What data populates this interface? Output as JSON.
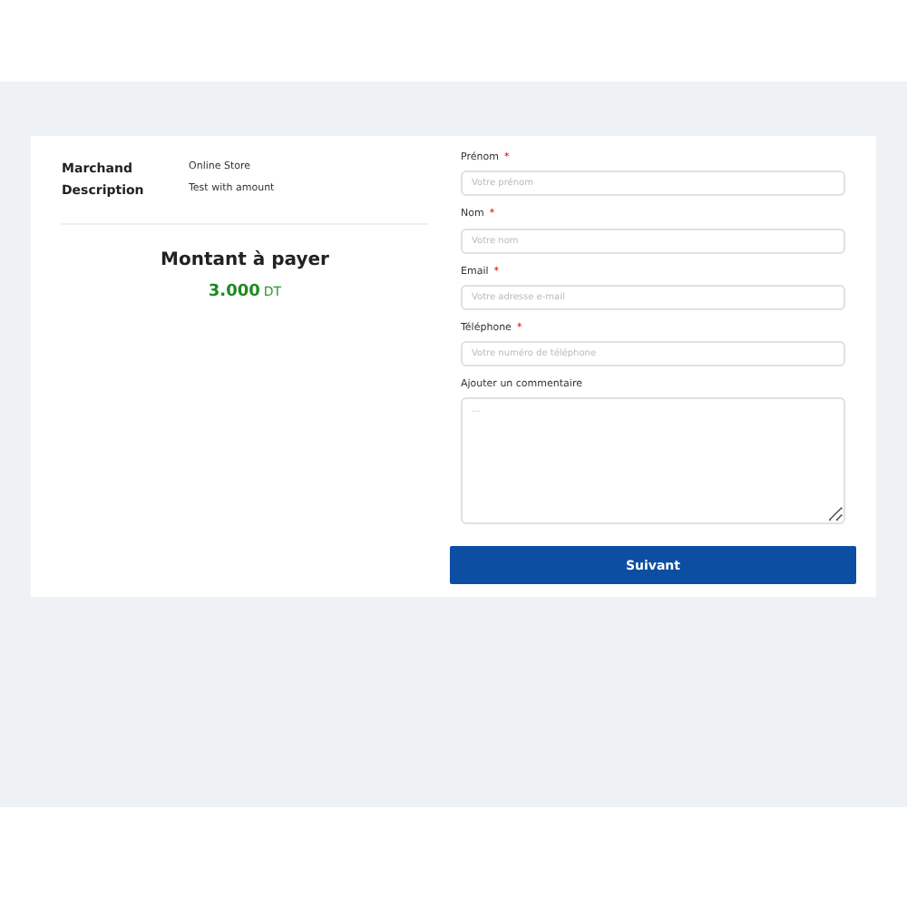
{
  "summary": {
    "rows": [
      {
        "label": "Marchand",
        "value": "Online Store"
      },
      {
        "label": "Description",
        "value": "Test with amount"
      }
    ],
    "amount_title": "Montant à payer",
    "amount": "3.000",
    "currency": "DT"
  },
  "form": {
    "fields": [
      {
        "kind": "input",
        "label": "Prénom",
        "required": true,
        "placeholder": "Votre prénom"
      },
      {
        "kind": "input",
        "label": "Nom",
        "required": true,
        "placeholder": "Votre nom"
      },
      {
        "kind": "input",
        "label": "Email",
        "required": true,
        "placeholder": "Votre adresse e-mail"
      },
      {
        "kind": "input",
        "label": "Téléphone",
        "required": true,
        "placeholder": "Votre numéro de téléphone"
      },
      {
        "kind": "textarea",
        "label": "Ajouter un commentaire",
        "required": false,
        "placeholder": "..."
      }
    ],
    "required_mark": "*",
    "submit": "Suivant"
  }
}
